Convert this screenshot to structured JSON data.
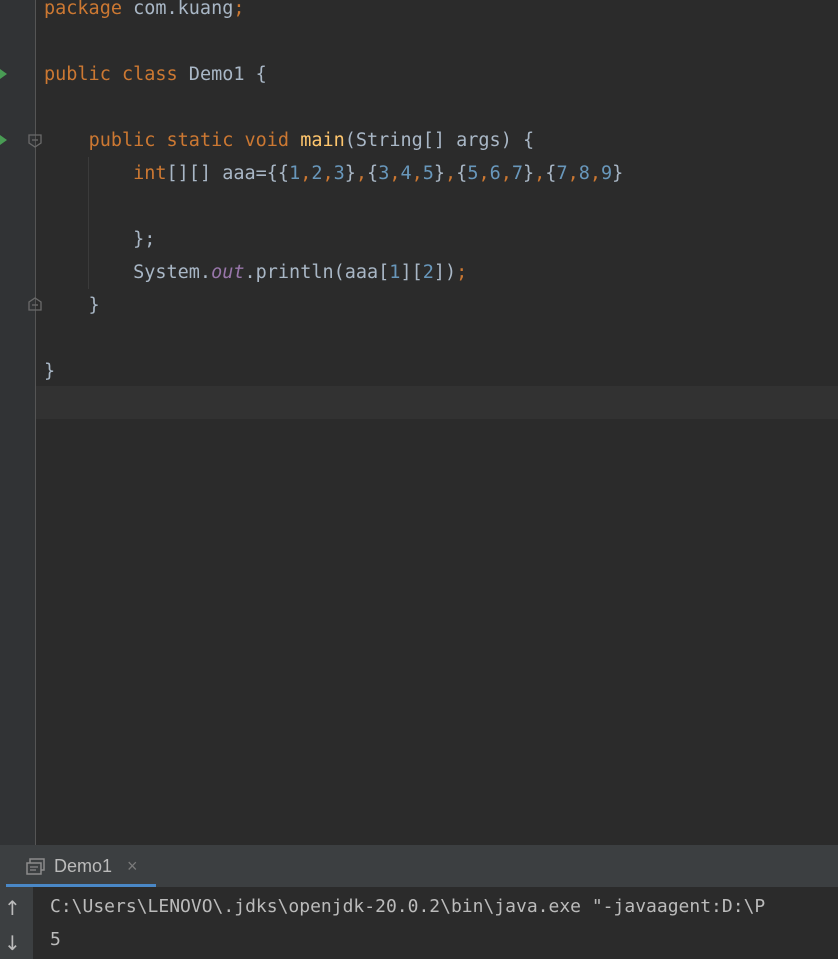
{
  "editor": {
    "code_lines": [
      [
        {
          "t": "package",
          "c": "kw"
        },
        {
          "t": " com.kuang"
        },
        {
          "t": ";",
          "c": "kw"
        }
      ],
      [],
      [
        {
          "t": "public",
          "c": "kw"
        },
        {
          "t": " "
        },
        {
          "t": "class",
          "c": "kw"
        },
        {
          "t": " Demo1 {"
        }
      ],
      [],
      [
        {
          "t": "    "
        },
        {
          "t": "public",
          "c": "kw"
        },
        {
          "t": " "
        },
        {
          "t": "static",
          "c": "kw"
        },
        {
          "t": " "
        },
        {
          "t": "void",
          "c": "kw"
        },
        {
          "t": " "
        },
        {
          "t": "main",
          "c": "fn"
        },
        {
          "t": "(String[] args) {"
        }
      ],
      [
        {
          "t": "        "
        },
        {
          "t": "int",
          "c": "kw"
        },
        {
          "t": "[][] aaa={{"
        },
        {
          "t": "1",
          "c": "num"
        },
        {
          "t": ",",
          "c": "kw"
        },
        {
          "t": "2",
          "c": "num"
        },
        {
          "t": ",",
          "c": "kw"
        },
        {
          "t": "3",
          "c": "num"
        },
        {
          "t": "}"
        },
        {
          "t": ",",
          "c": "kw"
        },
        {
          "t": "{"
        },
        {
          "t": "3",
          "c": "num"
        },
        {
          "t": ",",
          "c": "kw"
        },
        {
          "t": "4",
          "c": "num"
        },
        {
          "t": ",",
          "c": "kw"
        },
        {
          "t": "5",
          "c": "num"
        },
        {
          "t": "}"
        },
        {
          "t": ",",
          "c": "kw"
        },
        {
          "t": "{"
        },
        {
          "t": "5",
          "c": "num"
        },
        {
          "t": ",",
          "c": "kw"
        },
        {
          "t": "6",
          "c": "num"
        },
        {
          "t": ",",
          "c": "kw"
        },
        {
          "t": "7",
          "c": "num"
        },
        {
          "t": "}"
        },
        {
          "t": ",",
          "c": "kw"
        },
        {
          "t": "{"
        },
        {
          "t": "7",
          "c": "num"
        },
        {
          "t": ",",
          "c": "kw"
        },
        {
          "t": "8",
          "c": "num"
        },
        {
          "t": ",",
          "c": "kw"
        },
        {
          "t": "9",
          "c": "num"
        },
        {
          "t": "}"
        }
      ],
      [],
      [
        {
          "t": "        };"
        }
      ],
      [
        {
          "t": "        System."
        },
        {
          "t": "out",
          "c": "fld"
        },
        {
          "t": ".println(aaa["
        },
        {
          "t": "1",
          "c": "num"
        },
        {
          "t": "]["
        },
        {
          "t": "2",
          "c": "num"
        },
        {
          "t": "])"
        },
        {
          "t": ";",
          "c": "kw"
        }
      ],
      [
        {
          "t": "    }"
        }
      ],
      [],
      [
        {
          "t": "}"
        }
      ]
    ]
  },
  "run_panel": {
    "tab_label": "Demo1",
    "tab_close": "×",
    "rerun_up_icon": "↑",
    "down_icon": "↓",
    "console_lines": [
      "C:\\Users\\LENOVO\\.jdks\\openjdk-20.0.2\\bin\\java.exe \"-javaagent:D:\\P",
      "5"
    ]
  },
  "colors": {
    "background": "#2b2b2b",
    "keyword": "#cc7832",
    "method": "#ffc66d",
    "number": "#6897bb",
    "field": "#9876aa",
    "text": "#a9b7c6",
    "run_marker": "#499c54"
  }
}
